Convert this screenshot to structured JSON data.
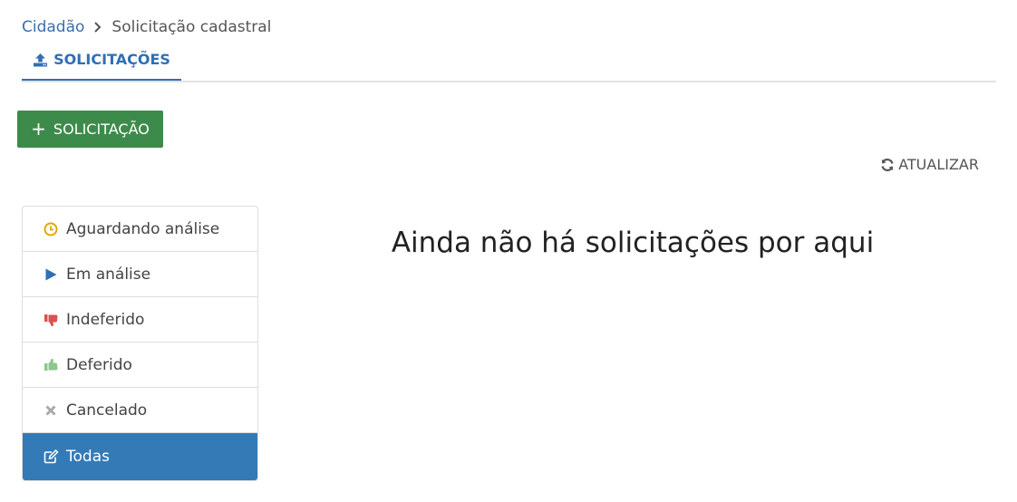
{
  "breadcrumb": {
    "root": "Cidadão",
    "current": "Solicitação cadastral"
  },
  "tabs": {
    "active_label": "SOLICITAÇÕES"
  },
  "actions": {
    "new_request_label": "SOLICITAÇÃO",
    "refresh_label": "ATUALIZAR"
  },
  "filters": {
    "items": [
      {
        "label": "Aguardando análise",
        "icon": "clock-icon",
        "color": "#e0a800"
      },
      {
        "label": "Em análise",
        "icon": "play-icon",
        "color": "#2f6fb5"
      },
      {
        "label": "Indeferido",
        "icon": "thumbs-down-icon",
        "color": "#d9534f"
      },
      {
        "label": "Deferido",
        "icon": "thumbs-up-icon",
        "color": "#8cc68c"
      },
      {
        "label": "Cancelado",
        "icon": "times-icon",
        "color": "#aaaaaa"
      },
      {
        "label": "Todas",
        "icon": "edit-icon",
        "color": "#ffffff",
        "active": true
      }
    ]
  },
  "main": {
    "empty_message": "Ainda não há solicitações por aqui"
  },
  "colors": {
    "accent": "#2f6fb5",
    "primary_button": "#3d8b4a",
    "active_filter": "#337ab7"
  }
}
